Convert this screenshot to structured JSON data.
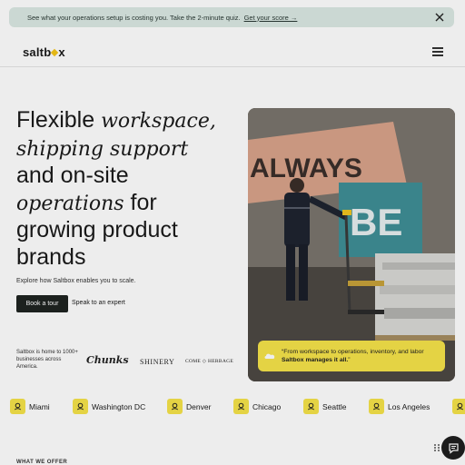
{
  "banner": {
    "text": "See what your operations setup is costing you. Take the 2-minute quiz.",
    "link": "Get your score →"
  },
  "nav": {
    "logo_left": "saltb",
    "logo_right": "x"
  },
  "hero": {
    "line1_plain": "Flexible ",
    "line1_italic": "workspace,",
    "line2_italic": "shipping support",
    "line3_plain": "and on-site",
    "line4_italic": "operations",
    "line4_plain": " for",
    "line5_plain": "growing product",
    "line6_plain": "brands",
    "subtext": "Explore how Saltbox enables you to scale.",
    "primary_button": "Book a tour",
    "secondary_link": "Speak to an expert"
  },
  "social_proof": {
    "home_to": "Saltbox is home to 1000+ businesses across America.",
    "brands": [
      "Chunks",
      "SHINERY",
      "COME ◇ HERBAGE"
    ]
  },
  "photo": {
    "wall_text_1": "ALWAYS",
    "wall_text_2": "BE"
  },
  "quote": {
    "text_regular": "“From workspace to operations, inventory, and labor ",
    "text_bold": "Saltbox manages it all.",
    "text_end": "”"
  },
  "cities": [
    "Miami",
    "Washington DC",
    "Denver",
    "Chicago",
    "Seattle",
    "Los Angeles"
  ],
  "section_label": "WHAT WE OFFER",
  "colors": {
    "accent_yellow": "#f6e44a",
    "banner_bg": "#dbe9e3",
    "dark_button": "#1f2421"
  }
}
